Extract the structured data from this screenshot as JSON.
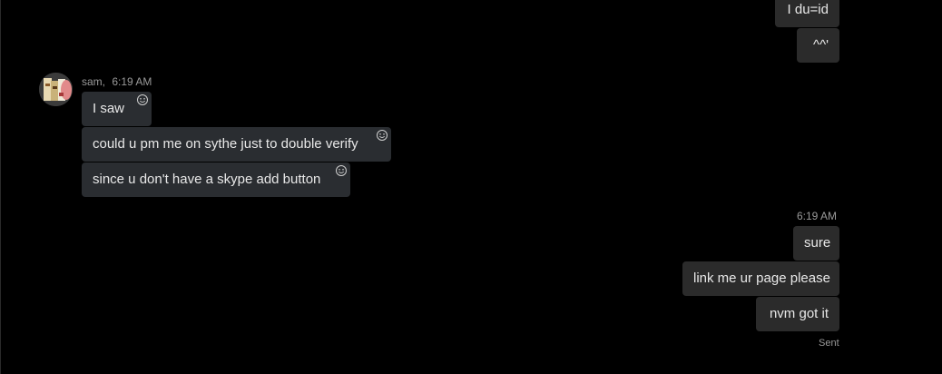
{
  "outgoing_top": [
    {
      "text": "I du=id"
    },
    {
      "text": "^^'"
    }
  ],
  "incoming": {
    "sender": "sam,",
    "time": "6:19 AM",
    "messages": [
      {
        "text": "I saw"
      },
      {
        "text": "could u pm me on sythe just to double verify"
      },
      {
        "text": "since u don't have a skype add button"
      }
    ]
  },
  "outgoing_bottom": {
    "time": "6:19 AM",
    "messages": [
      {
        "text": "sure"
      },
      {
        "text": "link me ur page please"
      },
      {
        "text": "nvm got it"
      }
    ],
    "status": "Sent"
  },
  "icons": {
    "avatar": "avatar-image",
    "react": "smiley-reaction-icon"
  }
}
